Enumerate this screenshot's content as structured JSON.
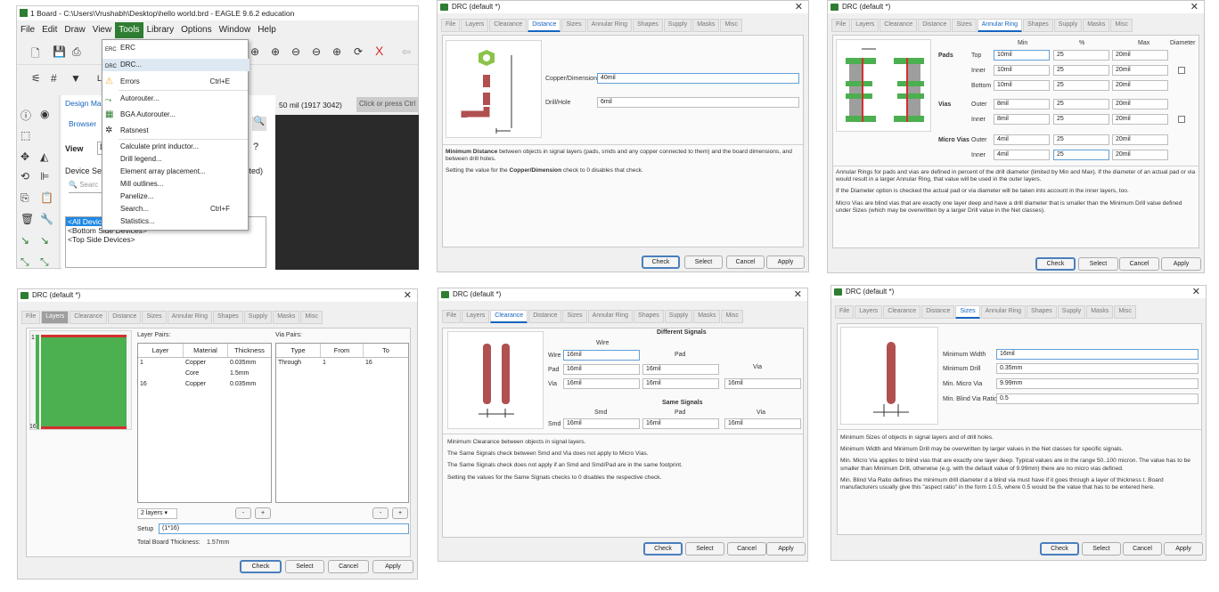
{
  "eagle": {
    "title": "1 Board - C:\\Users\\Vrushabh\\Desktop\\hello world.brd - EAGLE 9.6.2 education",
    "menubar": [
      "File",
      "Edit",
      "Draw",
      "View",
      "Tools",
      "Library",
      "Options",
      "Window",
      "Help"
    ],
    "layer_fragment": "L",
    "design_manager_tab": "Design Man",
    "browser_tab": "Browser",
    "view_label": "View",
    "view_value": "D",
    "device_sets_label": "Device Set",
    "search_placeholder": "Searc",
    "tree": [
      "<All Devic",
      "<Bottom Side Devices>",
      "<Top Side Devices>"
    ],
    "right_fragment": "cted)",
    "coord_readout": "50 mil (1917 3042)",
    "cmd_placeholder": "Click or press Ctrl",
    "tools_menu": {
      "items": [
        {
          "label": "ERC",
          "shortcut": "",
          "icon": "erc-icon",
          "icon_text": "ERC"
        },
        {
          "label": "DRC...",
          "shortcut": "",
          "icon": "drc-icon",
          "icon_text": "DRC"
        },
        {
          "label": "Errors",
          "shortcut": "Ctrl+E",
          "icon": "warning-icon",
          "icon_text": "⚠"
        },
        {
          "label": "Autorouter...",
          "shortcut": "",
          "icon": "autorouter-icon",
          "icon_text": "⤳"
        },
        {
          "label": "BGA Autorouter...",
          "shortcut": "",
          "icon": "bga-autorouter-icon",
          "icon_text": "▦"
        },
        {
          "label": "Ratsnest",
          "shortcut": "",
          "icon": "ratsnest-icon",
          "icon_text": "✲"
        },
        {
          "label": "Calculate print inductor...",
          "shortcut": "",
          "icon": "",
          "icon_text": ""
        },
        {
          "label": "Drill legend...",
          "shortcut": "",
          "icon": "",
          "icon_text": ""
        },
        {
          "label": "Element array placement...",
          "shortcut": "",
          "icon": "",
          "icon_text": ""
        },
        {
          "label": "Mill outlines...",
          "shortcut": "",
          "icon": "",
          "icon_text": ""
        },
        {
          "label": "Panelize...",
          "shortcut": "",
          "icon": "",
          "icon_text": ""
        },
        {
          "label": "Search...",
          "shortcut": "Ctrl+F",
          "icon": "",
          "icon_text": ""
        },
        {
          "label": "Statistics...",
          "shortcut": "",
          "icon": "",
          "icon_text": ""
        }
      ]
    }
  },
  "drc_common": {
    "title": "DRC (default *)",
    "tabs": [
      "File",
      "Layers",
      "Clearance",
      "Distance",
      "Sizes",
      "Annular Ring",
      "Shapes",
      "Supply",
      "Masks",
      "Misc"
    ],
    "buttons": [
      "Check",
      "Select",
      "Cancel",
      "Apply"
    ]
  },
  "distance": {
    "copper_label": "Copper/Dimension",
    "copper_value": "40mil",
    "drill_label": "Drill/Hole",
    "drill_value": "6mil",
    "desc_1_bold": "Minimum Distance",
    "desc_1_rest": " between objects in signal layers (pads, smds and any copper connected to them) and the board dimensions, and between drill holes.",
    "desc_2_a": "Setting the value for the ",
    "desc_2_bold": "Copper/Dimension",
    "desc_2_c": " check to 0 disables that check."
  },
  "annular": {
    "headers": {
      "min": "Min",
      "pct": "%",
      "max": "Max",
      "diameter": "Diameter"
    },
    "groups": {
      "pads": "Pads",
      "vias": "Vias",
      "micro": "Micro Vias"
    },
    "rows": [
      {
        "sub": "Top",
        "min": "10mil",
        "pct": "25",
        "max": "20mil"
      },
      {
        "sub": "Inner",
        "min": "10mil",
        "pct": "25",
        "max": "20mil"
      },
      {
        "sub": "Bottom",
        "min": "10mil",
        "pct": "25",
        "max": "20mil"
      },
      {
        "sub": "Outer",
        "min": "8mil",
        "pct": "25",
        "max": "20mil"
      },
      {
        "sub": "Inner",
        "min": "8mil",
        "pct": "25",
        "max": "20mil"
      },
      {
        "sub": "Outer",
        "min": "4mil",
        "pct": "25",
        "max": "20mil"
      },
      {
        "sub": "Inner",
        "min": "4mil",
        "pct": "25",
        "max": "20mil"
      }
    ],
    "desc_1": "Annular Rings for pads and vias are defined in percent of the drill diameter (limited by Min and Max). If the diameter of an actual pad or via would result in a larger Annular Ring, that value will be used in the outer layers.",
    "desc_2": "If the Diameter option is checked the actual pad or via diameter will be taken into account in the inner layers, too.",
    "desc_3": "Micro Vias are blind vias that are exactly one layer deep and have a drill diameter that is smaller than the Minimum Drill value defined under Sizes (which may be overwritten by a larger Drill value in the Net classes)."
  },
  "layers": {
    "layer_pairs_label": "Layer Pairs:",
    "via_pairs_label": "Via Pairs:",
    "cols": [
      "Layer",
      "Material",
      "Thickness"
    ],
    "rows": [
      [
        "1",
        "Copper",
        "0.035mm"
      ],
      [
        "",
        "Core",
        "1.5mm"
      ],
      [
        "16",
        "Copper",
        "0.035mm"
      ]
    ],
    "via_cols": [
      "Type",
      "From",
      "To"
    ],
    "via_rows": [
      [
        "Through",
        "1",
        "16"
      ]
    ],
    "marker_top": "1",
    "marker_bottom": "16",
    "count_select": "2 layers",
    "minus": "-",
    "plus": "+",
    "setup_label": "Setup",
    "setup_value": "(1*16)",
    "total_label": "Total Board Thickness:",
    "total_value": "1.57mm"
  },
  "clearance": {
    "diff_title": "Different Signals",
    "same_title": "Same Signals",
    "col_wire": "Wire",
    "col_pad": "Pad",
    "col_via": "Via",
    "col_smd": "Smd",
    "rows": [
      {
        "label": "Wire",
        "vals": [
          "16mil"
        ]
      },
      {
        "label": "Pad",
        "vals": [
          "16mil",
          "16mil"
        ]
      },
      {
        "label": "Via",
        "vals": [
          "16mil",
          "16mil",
          "16mil"
        ]
      }
    ],
    "same_row": {
      "label": "Smd",
      "vals": [
        "16mil",
        "16mil",
        "16mil"
      ]
    },
    "desc_1": "Minimum Clearance between objects in signal layers.",
    "desc_2": "The Same Signals check between Smd and Via does not apply to Micro Vias.",
    "desc_3": "The Same Signals check does not apply if an Smd and Smd/Pad are in the same footprint.",
    "desc_4": "Setting the values for the Same Signals checks to 0 disables the respective check."
  },
  "sizes": {
    "fields": [
      {
        "label": "Minimum Width",
        "value": "16mil"
      },
      {
        "label": "Minimum Drill",
        "value": "0.35mm"
      },
      {
        "label": "Min. Micro Via",
        "value": "9.99mm"
      },
      {
        "label": "Min. Blind Via Ratio",
        "value": "0.5"
      }
    ],
    "desc_1": "Minimum Sizes of objects in signal layers and of drill holes.",
    "desc_2": "Minimum Width and Minimum Drill may be overwritten by larger values in the Net classes for specific signals.",
    "desc_3": "Min. Micro Via applies to blind vias that are exactly one layer deep. Typical values are in the range 50..100 micron. The value has to be smaller than Minimum Drill, otherwise (e.g. with the default value of 9.99mm) there are no micro vias defined.",
    "desc_4": "Min. Blind Via Ratio defines the minimum drill diameter d a blind via must have if it goes through a layer of thickness t. Board manufacturers usually give this \"aspect ratio\" in the form 1:0.5, where 0.5 would be the value that has to be entered here."
  }
}
